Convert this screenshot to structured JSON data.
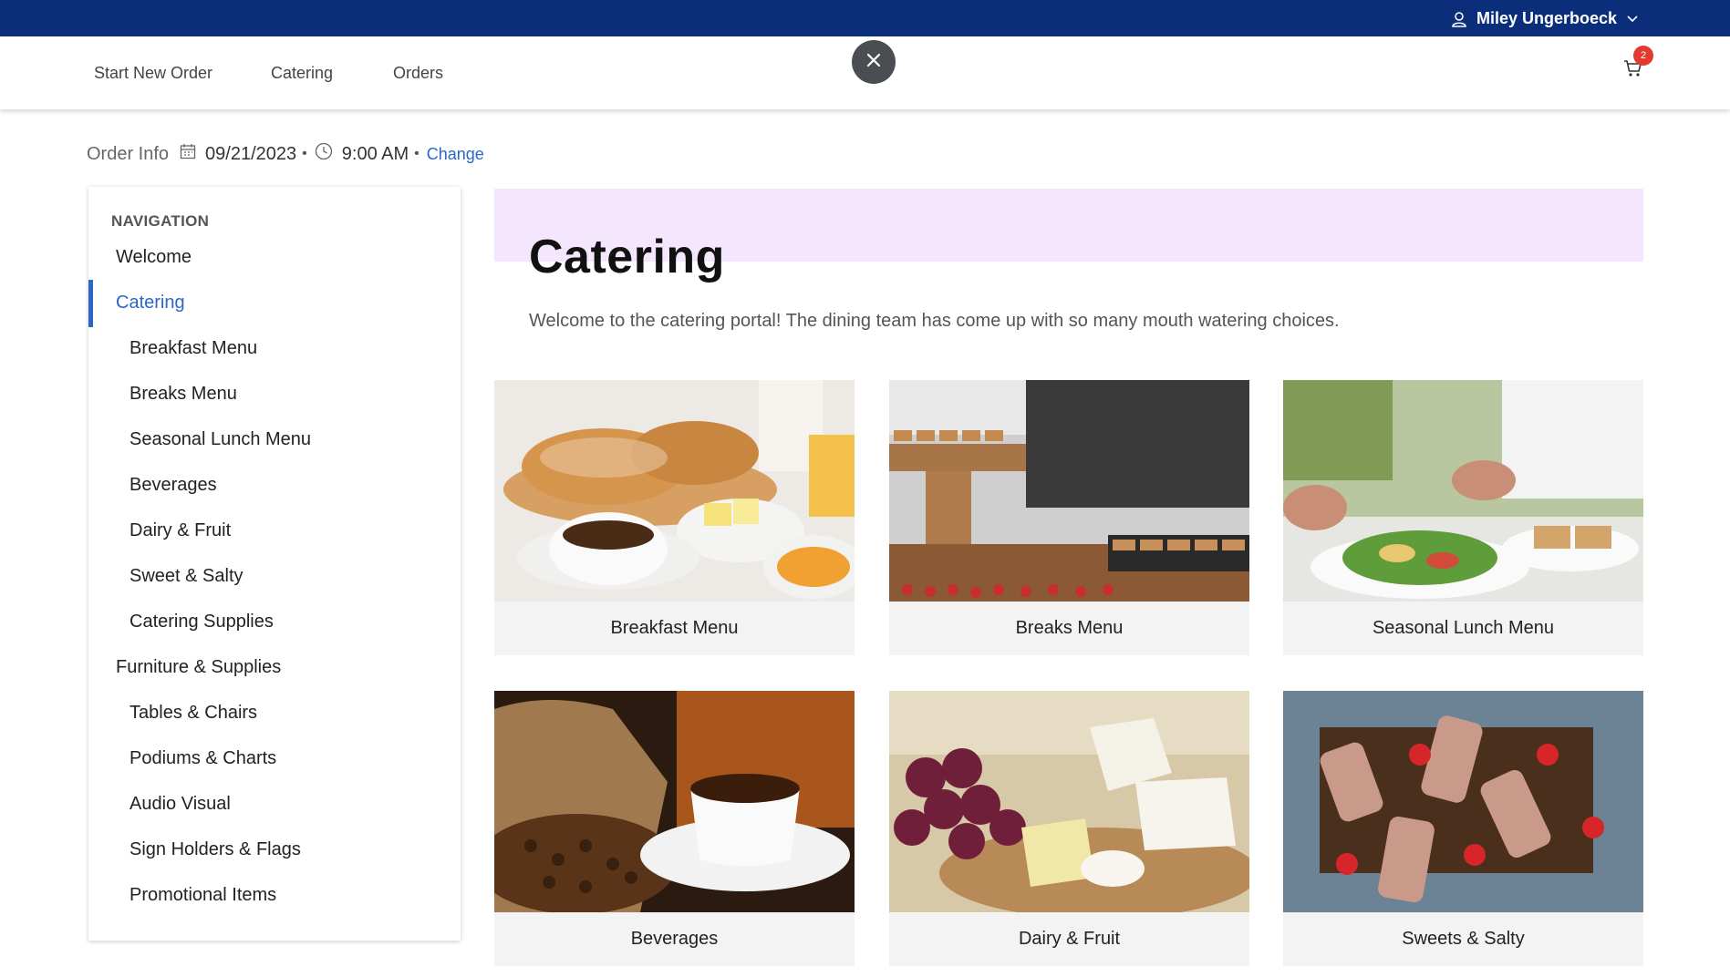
{
  "header": {
    "user_name": "Miley Ungerboeck"
  },
  "nav": {
    "links": [
      "Start New Order",
      "Catering",
      "Orders"
    ],
    "cart_count": "2"
  },
  "order_info": {
    "label": "Order Info",
    "date": "09/21/2023",
    "time": "9:00 AM",
    "separator": "•",
    "change": "Change"
  },
  "sidebar": {
    "heading": "NAVIGATION",
    "items": [
      {
        "label": "Welcome",
        "level": 0
      },
      {
        "label": "Catering",
        "level": 0,
        "active": true
      },
      {
        "label": "Breakfast Menu",
        "level": 1
      },
      {
        "label": "Breaks Menu",
        "level": 1
      },
      {
        "label": "Seasonal Lunch Menu",
        "level": 1
      },
      {
        "label": "Beverages",
        "level": 1
      },
      {
        "label": "Dairy & Fruit",
        "level": 1
      },
      {
        "label": "Sweet & Salty",
        "level": 1
      },
      {
        "label": "Catering Supplies",
        "level": 1
      },
      {
        "label": "Furniture & Supplies",
        "level": 0
      },
      {
        "label": "Tables & Chairs",
        "level": 1
      },
      {
        "label": "Podiums & Charts",
        "level": 1
      },
      {
        "label": "Audio Visual",
        "level": 1
      },
      {
        "label": "Sign Holders & Flags",
        "level": 1
      },
      {
        "label": "Promotional Items",
        "level": 1
      }
    ]
  },
  "main": {
    "title": "Catering",
    "subtitle": "Welcome to the catering portal! The dining team has come up with so many mouth watering choices.",
    "cards": [
      {
        "label": "Breakfast Menu",
        "icon": "breakfast-photo"
      },
      {
        "label": "Breaks Menu",
        "icon": "breaks-photo"
      },
      {
        "label": "Seasonal Lunch Menu",
        "icon": "lunch-photo"
      },
      {
        "label": "Beverages",
        "icon": "beverages-photo"
      },
      {
        "label": "Dairy & Fruit",
        "icon": "dairy-fruit-photo"
      },
      {
        "label": "Sweets & Salty",
        "icon": "sweets-salty-photo"
      }
    ]
  },
  "colors": {
    "topbar": "#0b2e7a",
    "accent": "#2b66c9",
    "hero_band": "#f3e6fd",
    "badge": "#e33a2f"
  }
}
